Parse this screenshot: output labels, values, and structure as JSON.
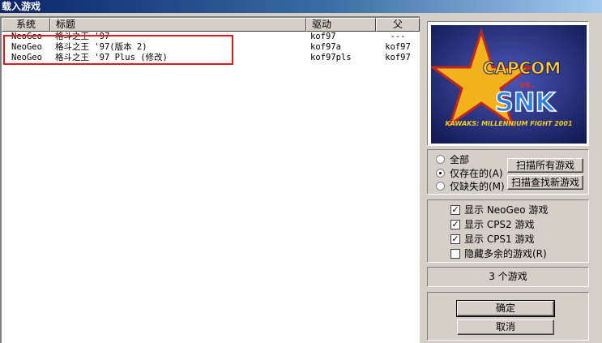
{
  "window": {
    "title": "载入游戏"
  },
  "list": {
    "columns": [
      "系统",
      "标题",
      "驱动",
      "父"
    ],
    "rows": [
      {
        "system": "NeoGeo",
        "title": "格斗之王 '97",
        "driver": "kof97",
        "parent": "---"
      },
      {
        "system": "NeoGeo",
        "title": "格斗之王 '97(版本 2)",
        "driver": "kof97a",
        "parent": "kof97"
      },
      {
        "system": "NeoGeo",
        "title": "格斗之王 '97 Plus (修改)",
        "driver": "kof97pls",
        "parent": "kof97"
      }
    ]
  },
  "preview": {
    "logo_top": "CAPCOM",
    "logo_vs": "vs.",
    "logo_bottom": "SNK",
    "subtitle": "KAWAKS: MILLENNIUM FIGHT 2001"
  },
  "filter": {
    "options": [
      {
        "label": "全部",
        "selected": false
      },
      {
        "label": "仅存在的(A)",
        "selected": true
      },
      {
        "label": "仅缺失的(M)",
        "selected": false
      }
    ],
    "scan_all_label": "扫描所有游戏",
    "scan_new_label": "扫描查找新游戏"
  },
  "show": {
    "items": [
      {
        "label": "显示 NeoGeo 游戏",
        "checked": true
      },
      {
        "label": "显示 CPS2 游戏",
        "checked": true
      },
      {
        "label": "显示 CPS1 游戏",
        "checked": true
      },
      {
        "label": "隐藏多余的游戏(R)",
        "checked": false
      }
    ]
  },
  "status": {
    "count_text": "3 个游戏"
  },
  "buttons": {
    "ok_label": "确定",
    "cancel_label": "取消"
  },
  "colors": {
    "highlight": "#e0181e",
    "titlebar": "#0a246a",
    "preview_bg": "#1e2a6e"
  }
}
